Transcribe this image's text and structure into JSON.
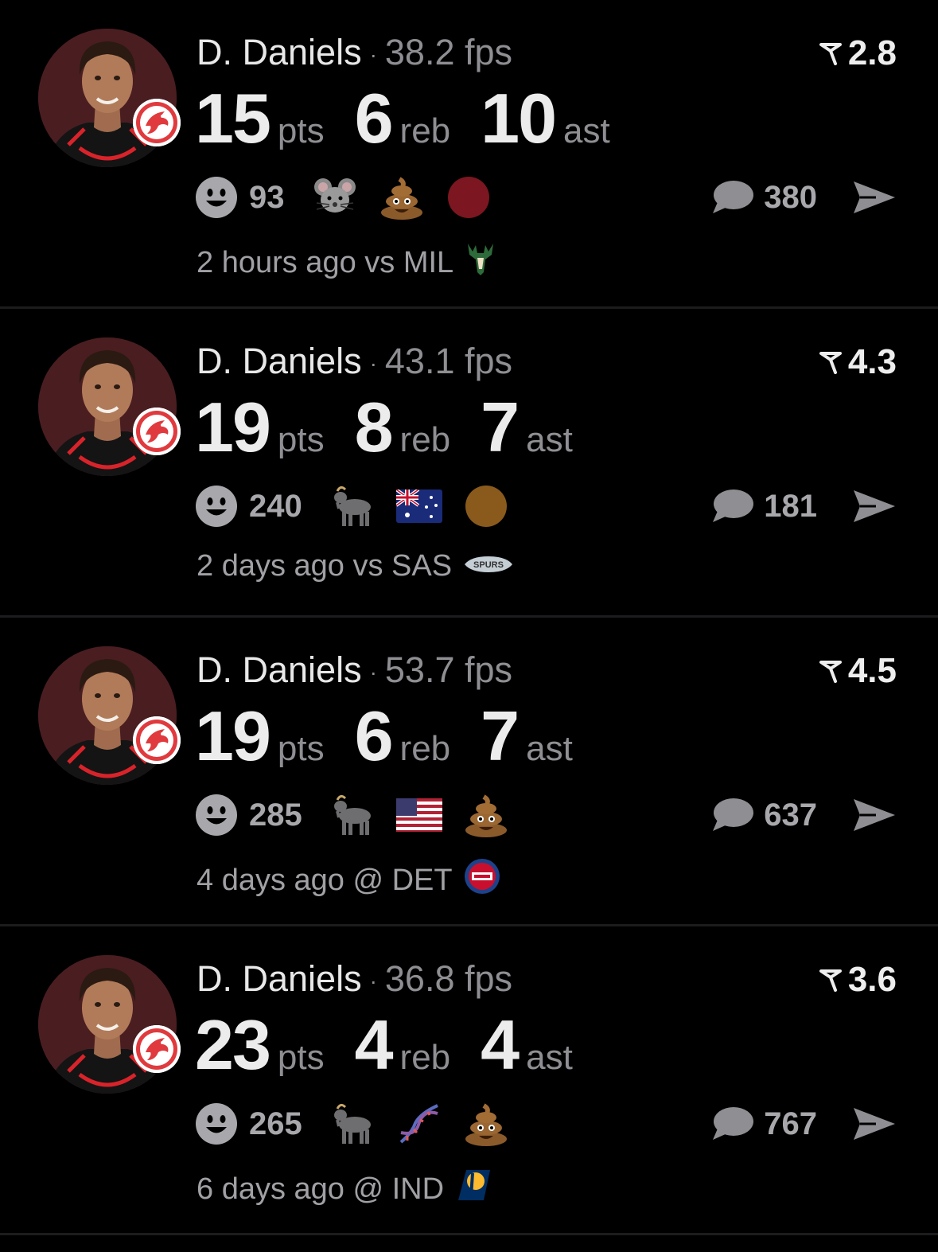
{
  "feed": [
    {
      "player": "D. Daniels",
      "sep": "·",
      "fps": "38.2 fps",
      "score": "2.8",
      "stats": [
        {
          "num": "15",
          "unit": "pts"
        },
        {
          "num": "6",
          "unit": "reb"
        },
        {
          "num": "10",
          "unit": "ast"
        }
      ],
      "smile_count": "93",
      "reactions": [
        "mouse-emoji",
        "poop-emoji",
        "red-circle-emoji"
      ],
      "comment_count": "380",
      "footer": "2 hours ago vs MIL",
      "team_logo": "bucks-logo"
    },
    {
      "player": "D. Daniels",
      "sep": "·",
      "fps": "43.1 fps",
      "score": "4.3",
      "stats": [
        {
          "num": "19",
          "unit": "pts"
        },
        {
          "num": "8",
          "unit": "reb"
        },
        {
          "num": "7",
          "unit": "ast"
        }
      ],
      "smile_count": "240",
      "reactions": [
        "goat-emoji",
        "australia-flag-emoji",
        "brown-circle-emoji"
      ],
      "comment_count": "181",
      "footer": "2 days ago vs SAS",
      "team_logo": "spurs-logo"
    },
    {
      "player": "D. Daniels",
      "sep": "·",
      "fps": "53.7 fps",
      "score": "4.5",
      "stats": [
        {
          "num": "19",
          "unit": "pts"
        },
        {
          "num": "6",
          "unit": "reb"
        },
        {
          "num": "7",
          "unit": "ast"
        }
      ],
      "smile_count": "285",
      "reactions": [
        "goat-emoji",
        "usa-flag-emoji",
        "poop-emoji"
      ],
      "comment_count": "637",
      "footer": "4 days ago @ DET",
      "team_logo": "pistons-logo"
    },
    {
      "player": "D. Daniels",
      "sep": "·",
      "fps": "36.8 fps",
      "score": "3.6",
      "stats": [
        {
          "num": "23",
          "unit": "pts"
        },
        {
          "num": "4",
          "unit": "reb"
        },
        {
          "num": "4",
          "unit": "ast"
        }
      ],
      "smile_count": "265",
      "reactions": [
        "goat-emoji",
        "dna-emoji",
        "poop-emoji"
      ],
      "comment_count": "767",
      "footer": "6 days ago @ IND",
      "team_logo": "pacers-logo"
    }
  ],
  "colors": {
    "background": "#000000",
    "muted": "#8e8e93",
    "avatar_bg": "#4a1d21",
    "hawks_red": "#e03a3e"
  },
  "icons": {
    "avatar": "player-photo",
    "badge": "hawks-logo",
    "score": "score-flag-icon",
    "smile": "smile-icon",
    "comment": "comment-icon",
    "share": "share-icon"
  }
}
